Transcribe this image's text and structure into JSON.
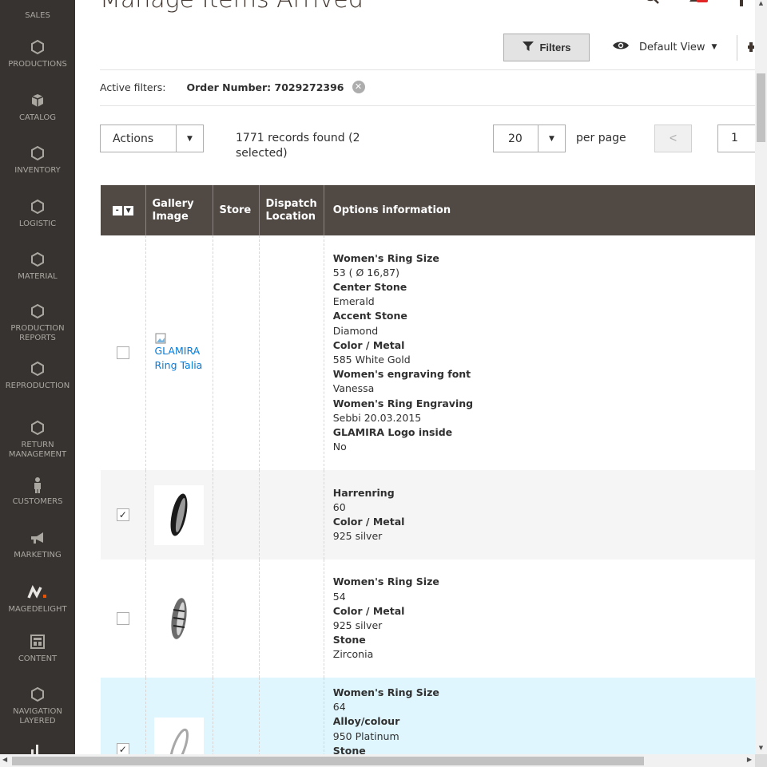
{
  "page_title": "Manage Items Arrived",
  "sidebar": {
    "items": [
      {
        "label": "SALES",
        "icon": "sales-icon"
      },
      {
        "label": "PRODUCTIONS",
        "icon": "hexagon-icon"
      },
      {
        "label": "CATALOG",
        "icon": "box-icon"
      },
      {
        "label": "INVENTORY",
        "icon": "hexagon-icon"
      },
      {
        "label": "LOGISTIC",
        "icon": "hexagon-icon"
      },
      {
        "label": "MATERIAL",
        "icon": "hexagon-icon"
      },
      {
        "label": "PRODUCTION REPORTS",
        "icon": "hexagon-icon"
      },
      {
        "label": "REPRODUCTION",
        "icon": "hexagon-icon"
      },
      {
        "label": "RETURN MANAGEMENT",
        "icon": "hexagon-icon"
      },
      {
        "label": "CUSTOMERS",
        "icon": "person-icon"
      },
      {
        "label": "MARKETING",
        "icon": "megaphone-icon"
      },
      {
        "label": "MAGEDELIGHT",
        "icon": "magedelight-icon"
      },
      {
        "label": "CONTENT",
        "icon": "layout-icon"
      },
      {
        "label": "NAVIGATION LAYERED",
        "icon": "hexagon-icon"
      }
    ]
  },
  "toolbar": {
    "filters_label": "Filters",
    "view_label": "Default View"
  },
  "active_filters": {
    "label": "Active filters:",
    "value": "Order Number: 7029272396"
  },
  "grid_controls": {
    "actions_label": "Actions",
    "records_text": "1771 records found (2 selected)",
    "per_page_value": "20",
    "per_page_label": "per page",
    "page_number": "1"
  },
  "columns": [
    "Gallery Image",
    "Store",
    "Dispatch Location",
    "Options information"
  ],
  "rows": [
    {
      "checked": false,
      "image_alt": "GLAMIRA Ring Talia",
      "options": [
        {
          "k": "Women's Ring Size",
          "v": "53 ( Ø 16,87)"
        },
        {
          "k": "Center Stone",
          "v": "Emerald"
        },
        {
          "k": "Accent Stone",
          "v": "Diamond"
        },
        {
          "k": "Color / Metal",
          "v": "585 White Gold"
        },
        {
          "k": "Women's engraving font",
          "v": "Vanessa"
        },
        {
          "k": "Women's Ring Engraving",
          "v": "Sebbi 20.03.2015"
        },
        {
          "k": "GLAMIRA Logo inside",
          "v": "No"
        }
      ]
    },
    {
      "checked": true,
      "image_alt": "",
      "options": [
        {
          "k": "Harrenring",
          "v": "60"
        },
        {
          "k": "Color / Metal",
          "v": "925 silver"
        }
      ]
    },
    {
      "checked": false,
      "image_alt": "",
      "options": [
        {
          "k": "Women's Ring Size",
          "v": "54"
        },
        {
          "k": "Color / Metal",
          "v": "925 silver"
        },
        {
          "k": "Stone",
          "v": "Zirconia"
        }
      ]
    },
    {
      "checked": true,
      "image_alt": "",
      "options": [
        {
          "k": "Women's Ring Size",
          "v": "64"
        },
        {
          "k": "Alloy/colour",
          "v": "950 Platinum"
        },
        {
          "k": "Stone",
          "v": ""
        }
      ]
    }
  ],
  "colors": {
    "sidebar_bg": "#373330",
    "header_bg": "#514943",
    "link": "#007bdb",
    "highlight_row": "#e0f6fe",
    "notification": "#e22626"
  }
}
